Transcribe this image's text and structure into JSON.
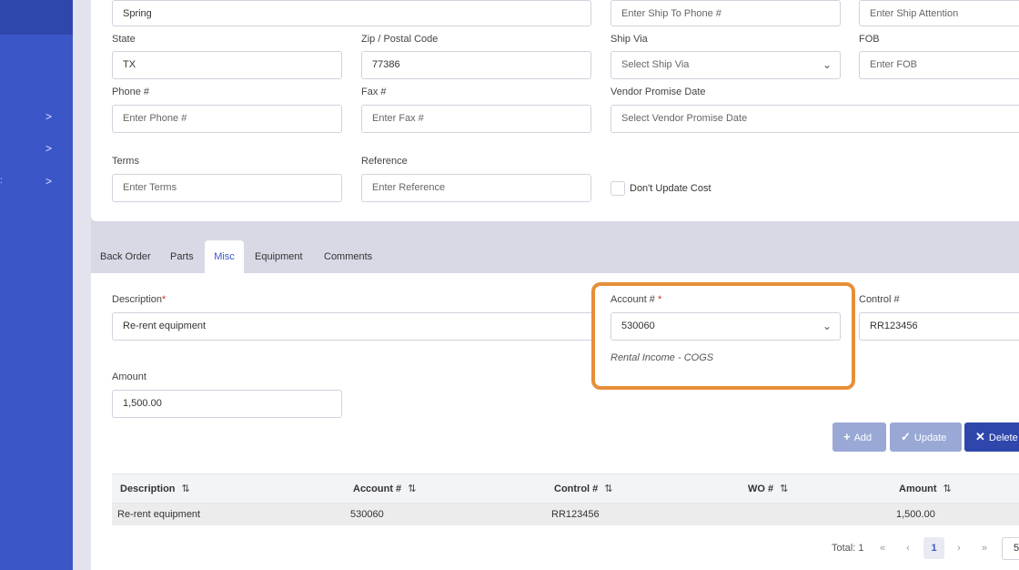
{
  "sidebar": {
    "chevrons": [
      ">",
      ">",
      ">"
    ]
  },
  "form": {
    "city_value": "Spring",
    "ship_to_phone_placeholder": "Enter Ship To Phone #",
    "ship_attention_placeholder": "Enter Ship Attention",
    "state_label": "State",
    "state_value": "TX",
    "zip_label": "Zip / Postal Code",
    "zip_value": "77386",
    "ship_via_label": "Ship Via",
    "ship_via_placeholder": "Select Ship Via",
    "fob_label": "FOB",
    "fob_placeholder": "Enter FOB",
    "phone_label": "Phone #",
    "phone_placeholder": "Enter Phone #",
    "fax_label": "Fax #",
    "fax_placeholder": "Enter Fax #",
    "vendor_promise_label": "Vendor Promise Date",
    "vendor_promise_placeholder": "Select Vendor Promise Date",
    "terms_label": "Terms",
    "terms_placeholder": "Enter Terms",
    "reference_label": "Reference",
    "reference_placeholder": "Enter Reference",
    "dont_update_cost_label": "Don't Update Cost"
  },
  "tabs": [
    {
      "label": "Back Order"
    },
    {
      "label": "Parts"
    },
    {
      "label": "Misc"
    },
    {
      "label": "Equipment"
    },
    {
      "label": "Comments"
    }
  ],
  "misc": {
    "description_label": "Description",
    "description_value": "Re-rent equipment",
    "account_label": "Account #",
    "account_value": "530060",
    "account_hint": "Rental Income - COGS",
    "control_label": "Control #",
    "control_value": "RR123456",
    "amount_label": "Amount",
    "amount_value": "1,500.00",
    "required_mark": "*"
  },
  "buttons": {
    "add": "Add",
    "update": "Update",
    "delete": "Delete"
  },
  "table": {
    "headers": [
      "Description",
      "Account #",
      "Control #",
      "WO #",
      "Amount"
    ],
    "rows": [
      {
        "description": "Re-rent equipment",
        "account": "530060",
        "control": "RR123456",
        "wo": "",
        "amount": "1,500.00"
      }
    ]
  },
  "pagination": {
    "total_text": "Total: 1",
    "current_page": "1",
    "page_size": "5"
  },
  "colors": {
    "accent": "#3b56c7",
    "highlight": "#e88e38"
  }
}
